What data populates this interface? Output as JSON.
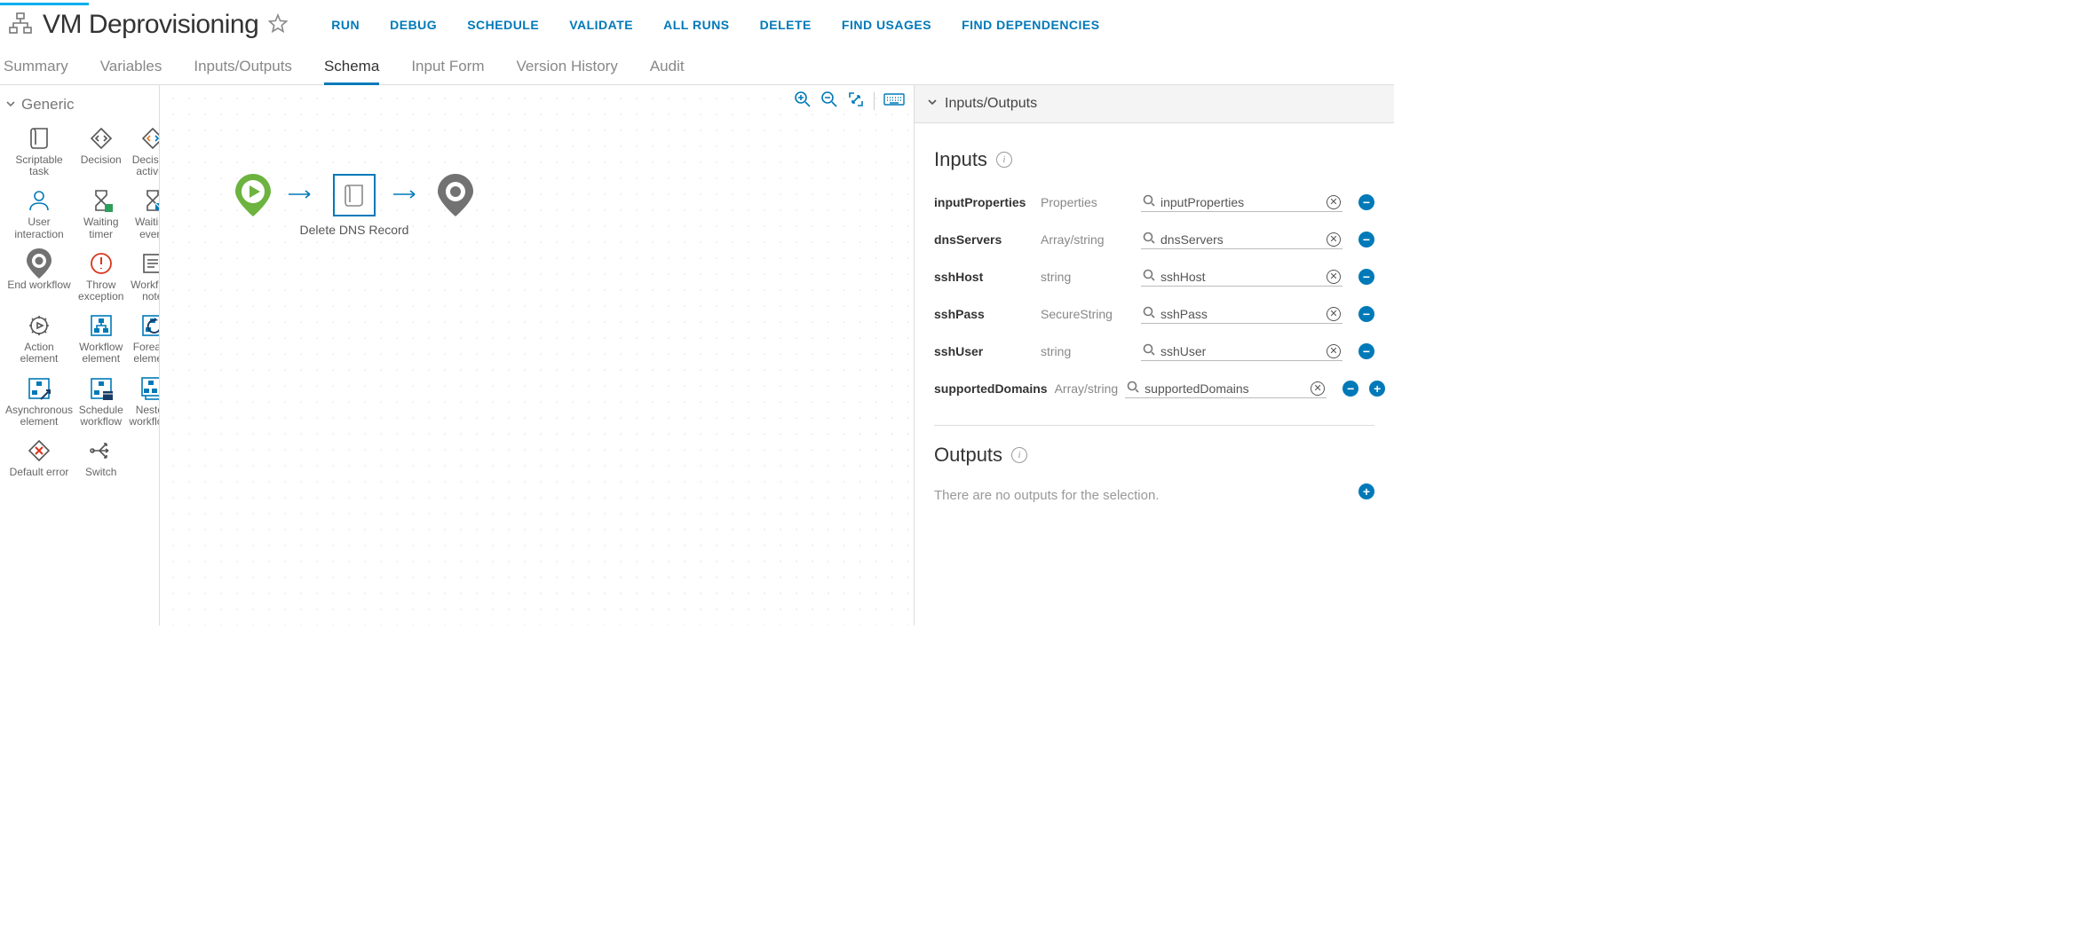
{
  "header": {
    "title": "VM Deprovisioning",
    "actions": [
      "RUN",
      "DEBUG",
      "SCHEDULE",
      "VALIDATE",
      "ALL RUNS",
      "DELETE",
      "FIND USAGES",
      "FIND DEPENDENCIES"
    ]
  },
  "tabs": [
    "Summary",
    "Variables",
    "Inputs/Outputs",
    "Schema",
    "Input Form",
    "Version History",
    "Audit"
  ],
  "active_tab": "Schema",
  "palette": {
    "section": "Generic",
    "items": [
      {
        "label": "Scriptable task",
        "icon": "script-icon"
      },
      {
        "label": "Decision",
        "icon": "decision-icon"
      },
      {
        "label": "Decision activity",
        "icon": "decision-activity-icon"
      },
      {
        "label": "User interaction",
        "icon": "user-icon"
      },
      {
        "label": "Waiting timer",
        "icon": "waiting-timer-icon"
      },
      {
        "label": "Waiting event",
        "icon": "waiting-event-icon"
      },
      {
        "label": "End workflow",
        "icon": "end-workflow-icon"
      },
      {
        "label": "Throw exception",
        "icon": "exception-icon"
      },
      {
        "label": "Workflow note",
        "icon": "note-icon"
      },
      {
        "label": "Action element",
        "icon": "action-element-icon"
      },
      {
        "label": "Workflow element",
        "icon": "workflow-element-icon"
      },
      {
        "label": "Foreach element",
        "icon": "foreach-element-icon"
      },
      {
        "label": "Asynchronous element",
        "icon": "async-element-icon"
      },
      {
        "label": "Schedule workflow",
        "icon": "schedule-workflow-icon"
      },
      {
        "label": "Nested workflows",
        "icon": "nested-workflows-icon"
      },
      {
        "label": "Default error",
        "icon": "default-error-icon"
      },
      {
        "label": "Switch",
        "icon": "switch-icon"
      }
    ]
  },
  "canvas": {
    "node_label": "Delete DNS Record"
  },
  "panel": {
    "title": "Inputs/Outputs",
    "inputs_title": "Inputs",
    "outputs_title": "Outputs",
    "outputs_note": "There are no outputs for the selection.",
    "inputs": [
      {
        "name": "inputProperties",
        "type": "Properties",
        "value": "inputProperties"
      },
      {
        "name": "dnsServers",
        "type": "Array/string",
        "value": "dnsServers"
      },
      {
        "name": "sshHost",
        "type": "string",
        "value": "sshHost"
      },
      {
        "name": "sshPass",
        "type": "SecureString",
        "value": "sshPass"
      },
      {
        "name": "sshUser",
        "type": "string",
        "value": "sshUser"
      },
      {
        "name": "supportedDomains",
        "type": "Array/string",
        "value": "supportedDomains"
      }
    ]
  }
}
